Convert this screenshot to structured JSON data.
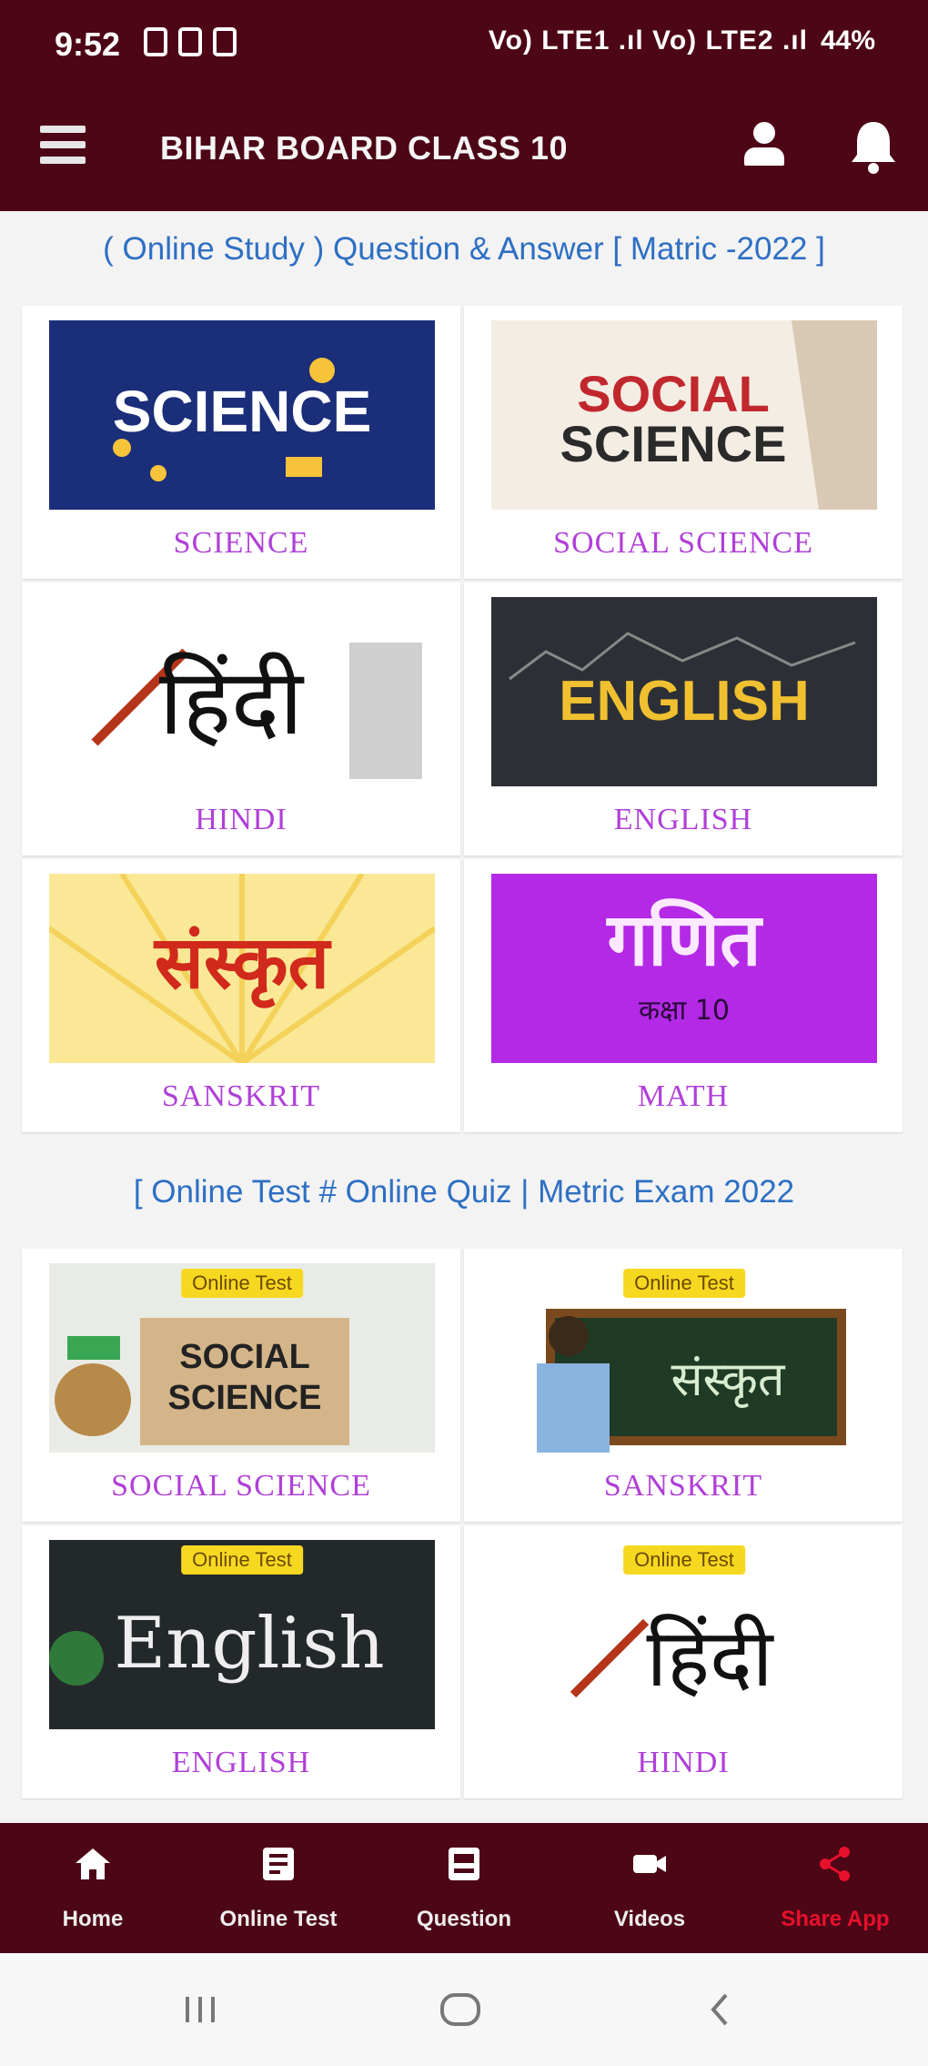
{
  "status_bar": {
    "time": "9:52",
    "network": "Vo) LTE1 .ıl Vo) LTE2 .ıl",
    "battery": "44%"
  },
  "app_bar": {
    "title": "BIHAR BOARD CLASS 10"
  },
  "section_study": {
    "title": "( Online Study ) Question & Answer [ Matric -2022 ]"
  },
  "study_cards": [
    {
      "label": "SCIENCE",
      "banner_text": "SCIENCE"
    },
    {
      "label": "SOCIAL SCIENCE",
      "banner_line1": "SOCIAL",
      "banner_line2": "SCIENCE"
    },
    {
      "label": "HINDI",
      "banner_text": "हिंदी"
    },
    {
      "label": "ENGLISH",
      "banner_text": "ENGLISH"
    },
    {
      "label": "SANSKRIT",
      "banner_text": "संस्कृत"
    },
    {
      "label": "MATH",
      "banner_text": "गणित",
      "banner_sub": "कक्षा 10"
    }
  ],
  "section_test": {
    "title": "[ Online Test # Online Quiz | Metric Exam 2022"
  },
  "test_cards": [
    {
      "label": "SOCIAL SCIENCE",
      "badge": "Online Test",
      "banner_line1": "SOCIAL",
      "banner_line2": "SCIENCE"
    },
    {
      "label": "SANSKRIT",
      "badge": "Online Test",
      "banner_text": "संस्कृत"
    },
    {
      "label": "ENGLISH",
      "badge": "Online Test",
      "banner_text": "English"
    },
    {
      "label": "HINDI",
      "badge": "Online Test",
      "banner_text": "हिंदी"
    }
  ],
  "bottom_nav": [
    {
      "label": "Home",
      "icon": "home-icon"
    },
    {
      "label": "Online Test",
      "icon": "test-icon"
    },
    {
      "label": "Question",
      "icon": "question-icon"
    },
    {
      "label": "Videos",
      "icon": "video-icon"
    },
    {
      "label": "Share App",
      "icon": "share-icon"
    }
  ],
  "colors": {
    "primary": "#4d0616",
    "label": "#b040d8",
    "section_title": "#2e6fc3",
    "active_nav": "#e8102c",
    "badge": "#f7d820"
  }
}
